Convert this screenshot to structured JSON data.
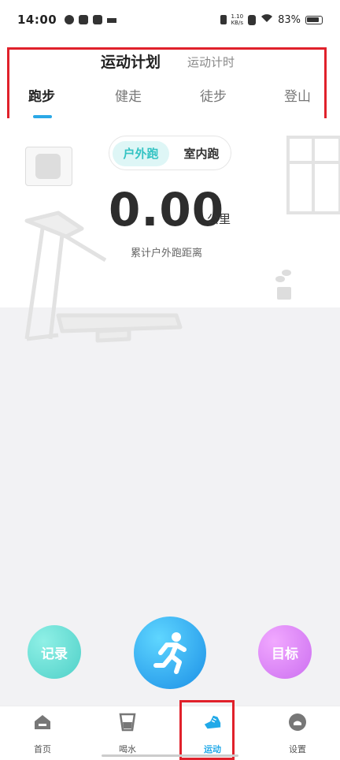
{
  "status_bar": {
    "time": "14:00",
    "net_speed_top": "1.10",
    "net_speed_bottom": "KB/s",
    "battery": "83%"
  },
  "header": {
    "plan_tabs": [
      "运动计划",
      "运动计时"
    ],
    "sport_tabs": [
      "跑步",
      "健走",
      "徒步",
      "登山"
    ],
    "active_sport_tab": "跑步"
  },
  "mode_toggle": {
    "active": "户外跑",
    "inactive": "室内跑"
  },
  "distance": {
    "value": "0.00",
    "unit": "公里",
    "label": "累计户外跑距离"
  },
  "actions": {
    "record": "记录",
    "start_icon": "running-person-icon",
    "goal": "目标"
  },
  "bottom_nav": {
    "items": [
      {
        "label": "首页",
        "icon": "home-icon"
      },
      {
        "label": "喝水",
        "icon": "water-cup-icon"
      },
      {
        "label": "运动",
        "icon": "sneaker-icon"
      },
      {
        "label": "设置",
        "icon": "settings-icon"
      }
    ],
    "active_index": 2
  },
  "colors": {
    "accent_blue": "#21a9e8",
    "teal": "#33c3c3",
    "purple": "#cc6ff0",
    "highlight_red": "#e0212b"
  }
}
